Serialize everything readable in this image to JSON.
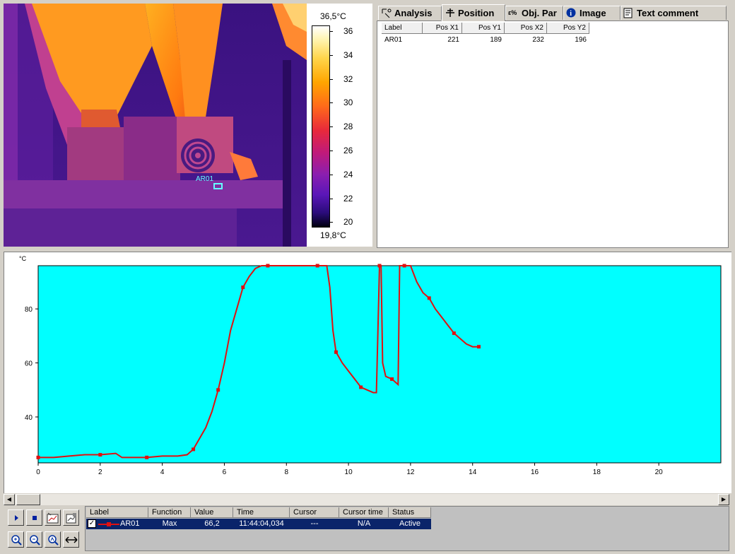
{
  "thermal": {
    "marker_label": "AR01",
    "scale_max": "36,5°C",
    "scale_min": "19,8°C",
    "scale_ticks": [
      "36",
      "34",
      "32",
      "30",
      "28",
      "26",
      "24",
      "22",
      "20"
    ]
  },
  "tabs": [
    {
      "label": "Analysis",
      "icon": "analysis-icon"
    },
    {
      "label": "Position",
      "icon": "position-icon",
      "active": true
    },
    {
      "label": "Obj. Par",
      "icon": "objpar-icon"
    },
    {
      "label": "Image",
      "icon": "info-icon"
    },
    {
      "label": "Text comment",
      "icon": "comment-icon"
    }
  ],
  "position_table": {
    "headers": [
      "Label",
      "Pos X1",
      "Pos Y1",
      "Pos X2",
      "Pos Y2"
    ],
    "rows": [
      [
        "AR01",
        "221",
        "189",
        "232",
        "196"
      ]
    ]
  },
  "chart_data": {
    "type": "line",
    "ylabel": "°C",
    "xlabel": "",
    "xlim": [
      0,
      22
    ],
    "ylim": [
      23,
      96
    ],
    "x_ticks": [
      "0",
      "2",
      "4",
      "6",
      "8",
      "10",
      "12",
      "14",
      "16",
      "18",
      "20"
    ],
    "y_ticks": [
      "40",
      "60",
      "80"
    ],
    "background": "#00ffff",
    "series": [
      {
        "name": "AR01",
        "color": "#e01010",
        "x": [
          0.0,
          0.5,
          1.0,
          1.5,
          2.0,
          2.5,
          2.7,
          3.0,
          3.5,
          4.0,
          4.5,
          4.8,
          5.0,
          5.2,
          5.4,
          5.6,
          5.8,
          6.0,
          6.2,
          6.4,
          6.6,
          6.8,
          7.0,
          7.2,
          7.4,
          7.6,
          8.0,
          8.5,
          9.0,
          9.3,
          9.4,
          9.5,
          9.6,
          9.8,
          10.0,
          10.2,
          10.4,
          10.6,
          10.8,
          10.9,
          11.0,
          11.05,
          11.1,
          11.2,
          11.4,
          11.6,
          11.65,
          11.7,
          11.8,
          12.0,
          12.2,
          12.4,
          12.6,
          12.8,
          13.0,
          13.2,
          13.4,
          13.6,
          13.8,
          14.0,
          14.2
        ],
        "y": [
          25,
          25,
          25.5,
          26,
          26,
          26.5,
          25,
          25,
          25,
          25.5,
          25.5,
          26,
          28,
          32,
          36,
          42,
          50,
          60,
          72,
          80,
          88,
          92,
          95,
          96,
          96,
          96,
          96,
          96,
          96,
          96,
          88,
          72,
          64,
          60,
          57,
          54,
          51,
          50,
          49,
          49,
          96,
          96,
          60,
          55,
          54,
          52,
          96,
          96,
          96,
          96,
          90,
          86,
          84,
          80,
          77,
          74,
          71,
          69,
          67,
          66,
          66
        ]
      }
    ]
  },
  "toolbar": {
    "buttons": [
      "play-icon",
      "stop-icon",
      "chart-export-icon",
      "chart-settings-icon",
      "zoom-in-icon",
      "zoom-out-icon",
      "zoom-fit-icon",
      "pan-horizontal-icon"
    ]
  },
  "legend": {
    "headers": [
      "Label",
      "Function",
      "Value",
      "Time",
      "Cursor",
      "Cursor time",
      "Status"
    ],
    "row": {
      "checked": true,
      "label": "AR01",
      "function": "Max",
      "value": "66,2",
      "time": "11:44:04,034",
      "cursor": "---",
      "cursor_time": "N/A",
      "status": "Active"
    }
  },
  "colors": {
    "selection": "#0a246a",
    "plot_bg": "#00ffff",
    "series": "#e01010"
  }
}
